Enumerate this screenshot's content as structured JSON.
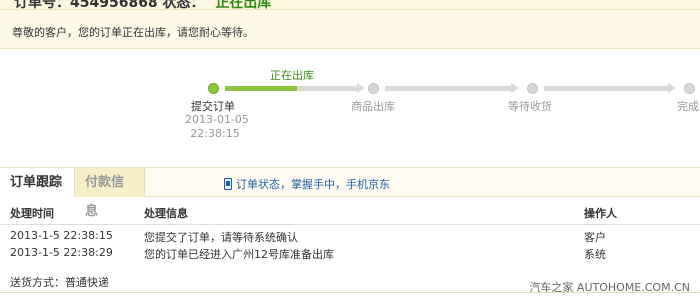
{
  "header": {
    "order_label_cut": "订单号：454956868",
    "status_label_cut": "状态：",
    "status_value": "正在出库"
  },
  "notice": "尊敬的客户，您的订单正在出库，请您耐心等待。",
  "progress": {
    "current_label": "正在出库",
    "steps": [
      {
        "label": "提交订单",
        "date": "2013-01-05",
        "time": "22:38:15"
      },
      {
        "label": "商品出库"
      },
      {
        "label": "等待收货"
      },
      {
        "label": "完成"
      }
    ]
  },
  "tabs": [
    {
      "label": "订单跟踪"
    },
    {
      "label": "付款信息"
    }
  ],
  "promo_text": "订单状态，掌握手中，手机京东",
  "table": {
    "headers": [
      "处理时间",
      "处理信息",
      "操作人"
    ],
    "rows": [
      [
        "2013-1-5 22:38:15",
        "您提交了订单，请等待系统确认",
        "客户"
      ],
      [
        "2013-1-5 22:38:29",
        "您的订单已经进入广州12号库准备出库",
        "系统"
      ]
    ]
  },
  "delivery": "送货方式：普通快递",
  "watermark": "汽车之家 AUTOHOME.COM.CN",
  "colors": {
    "accent_green": "#8cc63f",
    "status_green": "#2f8a12",
    "link_blue": "#1f5fa8",
    "notice_bg": "#fdf9e6"
  }
}
